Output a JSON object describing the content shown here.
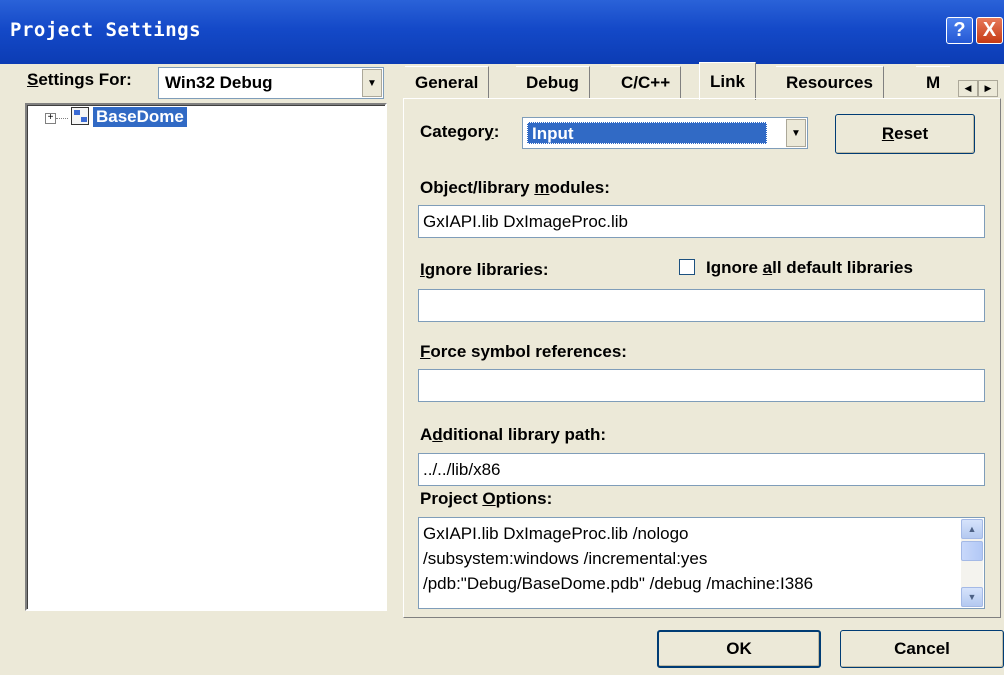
{
  "window": {
    "title": "Project Settings",
    "help_glyph": "?",
    "close_glyph": "X"
  },
  "settings_for": {
    "label_u": "S",
    "label_rest": "ettings For:",
    "value": "Win32 Debug"
  },
  "tree": {
    "expander": "+",
    "root_label": "BaseDome"
  },
  "tabs": [
    {
      "label": "General"
    },
    {
      "label": "Debug"
    },
    {
      "label": "C/C++"
    },
    {
      "label": "Link"
    },
    {
      "label": "Resources"
    },
    {
      "label": "M"
    }
  ],
  "active_tab": "Link",
  "link": {
    "category_label_pre": "Categor",
    "category_label_u": "y",
    "category_label_post": ":",
    "category_value": "Input",
    "reset_u": "R",
    "reset_rest": "eset",
    "objlib_label_pre": "Object/library ",
    "objlib_label_u": "m",
    "objlib_label_post": "odules:",
    "objlib_value": "GxIAPI.lib DxImageProc.lib",
    "ignore_label_u": "I",
    "ignore_label_rest": "gnore libraries:",
    "ignore_value": "",
    "ignore_all_pre": "Ignore ",
    "ignore_all_u": "a",
    "ignore_all_post": "ll default libraries",
    "ignore_all_checked": false,
    "force_label_u": "F",
    "force_label_rest": "orce symbol references:",
    "force_value": "",
    "addpath_label_pre": "A",
    "addpath_label_u": "d",
    "addpath_label_post": "ditional library path:",
    "addpath_value": "../../lib/x86",
    "options_label_pre": "Project ",
    "options_label_u": "O",
    "options_label_post": "ptions:",
    "options_lines": [
      "GxIAPI.lib DxImageProc.lib /nologo",
      "/subsystem:windows /incremental:yes",
      "/pdb:\"Debug/BaseDome.pdb\" /debug /machine:I386"
    ]
  },
  "buttons": {
    "ok": "OK",
    "cancel": "Cancel"
  },
  "colors": {
    "titlebar": "#0c3cb4",
    "selection": "#316ac5",
    "dialog": "#ece9d8"
  }
}
